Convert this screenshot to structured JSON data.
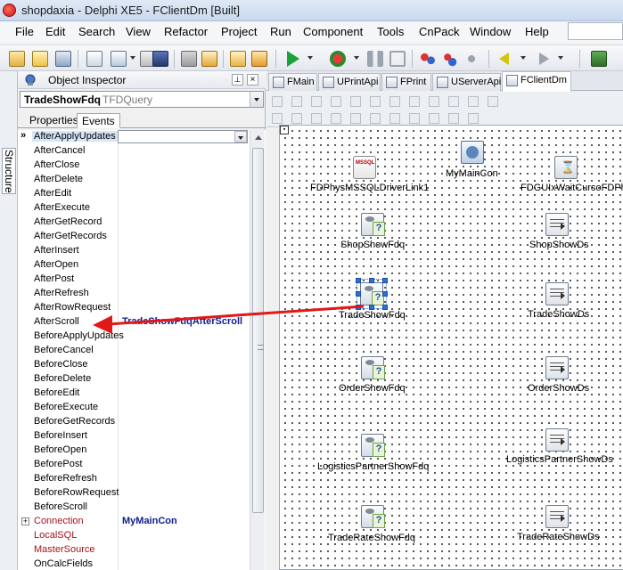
{
  "window": {
    "title": "shopdaxia - Delphi XE5 - FClientDm [Built]"
  },
  "menu": [
    "File",
    "Edit",
    "Search",
    "View",
    "Refactor",
    "Project",
    "Run",
    "Component",
    "Tools",
    "CnPack",
    "Window",
    "Help"
  ],
  "structure_tab": {
    "label": "Structure"
  },
  "object_inspector": {
    "title": "Object Inspector",
    "pin": "⊥",
    "close": "×",
    "selected_object": {
      "name": "TradeShowFdq",
      "type": "TFDQuery"
    },
    "tabs": {
      "properties": "Properties",
      "events": "Events"
    },
    "marker": "»",
    "events": [
      {
        "name": "AfterApplyUpdates",
        "value": "",
        "selected": true
      },
      {
        "name": "AfterCancel",
        "value": ""
      },
      {
        "name": "AfterClose",
        "value": ""
      },
      {
        "name": "AfterDelete",
        "value": ""
      },
      {
        "name": "AfterEdit",
        "value": ""
      },
      {
        "name": "AfterExecute",
        "value": ""
      },
      {
        "name": "AfterGetRecord",
        "value": ""
      },
      {
        "name": "AfterGetRecords",
        "value": ""
      },
      {
        "name": "AfterInsert",
        "value": ""
      },
      {
        "name": "AfterOpen",
        "value": ""
      },
      {
        "name": "AfterPost",
        "value": ""
      },
      {
        "name": "AfterRefresh",
        "value": ""
      },
      {
        "name": "AfterRowRequest",
        "value": ""
      },
      {
        "name": "AfterScroll",
        "value": "TradeShowFdqAfterScroll"
      },
      {
        "name": "BeforeApplyUpdates",
        "value": ""
      },
      {
        "name": "BeforeCancel",
        "value": ""
      },
      {
        "name": "BeforeClose",
        "value": ""
      },
      {
        "name": "BeforeDelete",
        "value": ""
      },
      {
        "name": "BeforeEdit",
        "value": ""
      },
      {
        "name": "BeforeExecute",
        "value": ""
      },
      {
        "name": "BeforeGetRecords",
        "value": ""
      },
      {
        "name": "BeforeInsert",
        "value": ""
      },
      {
        "name": "BeforeOpen",
        "value": ""
      },
      {
        "name": "BeforePost",
        "value": ""
      },
      {
        "name": "BeforeRefresh",
        "value": ""
      },
      {
        "name": "BeforeRowRequest",
        "value": ""
      },
      {
        "name": "BeforeScroll",
        "value": ""
      },
      {
        "name": "Connection",
        "value": "MyMainCon",
        "red": true,
        "expandable": true
      },
      {
        "name": "LocalSQL",
        "value": "",
        "red": true
      },
      {
        "name": "MasterSource",
        "value": "",
        "red": true
      },
      {
        "name": "OnCalcFields",
        "value": ""
      }
    ]
  },
  "designer": {
    "tabs": [
      "FMain",
      "UPrintApi",
      "FPrint",
      "UServerApi",
      "FClientDm"
    ],
    "active_tab": "FClientDm",
    "components": [
      {
        "id": "mssql-driver-link",
        "label": "FDPhysMSSQLDriverLink1",
        "icon": "mssql-driver-icon"
      },
      {
        "id": "main-connection",
        "label": "MyMainCon",
        "icon": "connection-icon"
      },
      {
        "id": "wait-cursor",
        "label": "FDGUIxWaitCursoFDPhy",
        "icon": "hourglass-icon"
      },
      {
        "id": "shop-show-fdq",
        "label": "ShopShowFdq",
        "icon": "query-icon"
      },
      {
        "id": "shop-show-ds",
        "label": "ShopShowDs",
        "icon": "datasource-icon"
      },
      {
        "id": "trade-show-fdq",
        "label": "TradeShowFdq",
        "icon": "query-icon",
        "selected": true
      },
      {
        "id": "trade-show-ds",
        "label": "TradeShowDs",
        "icon": "datasource-icon"
      },
      {
        "id": "order-show-fdq",
        "label": "OrderShowFdq",
        "icon": "query-icon"
      },
      {
        "id": "order-show-ds",
        "label": "OrderShowDs",
        "icon": "datasource-icon"
      },
      {
        "id": "logistics-partner-show-fdq",
        "label": "LogisticsPartnerShowFdq",
        "icon": "query-icon"
      },
      {
        "id": "logistics-partner-show-ds",
        "label": "LogisticsPartnerShowDs",
        "icon": "datasource-icon"
      },
      {
        "id": "trade-rate-show-fdq",
        "label": "TradeRateShowFdq",
        "icon": "query-icon"
      },
      {
        "id": "trade-rate-show-ds",
        "label": "TradeRateShowDs",
        "icon": "datasource-icon"
      }
    ]
  },
  "colors": {
    "annotation_arrow": "#e01818",
    "event_value": "#0d1d8f",
    "required_property": "#a3121a",
    "selection_handle": "#2f6fd6"
  }
}
